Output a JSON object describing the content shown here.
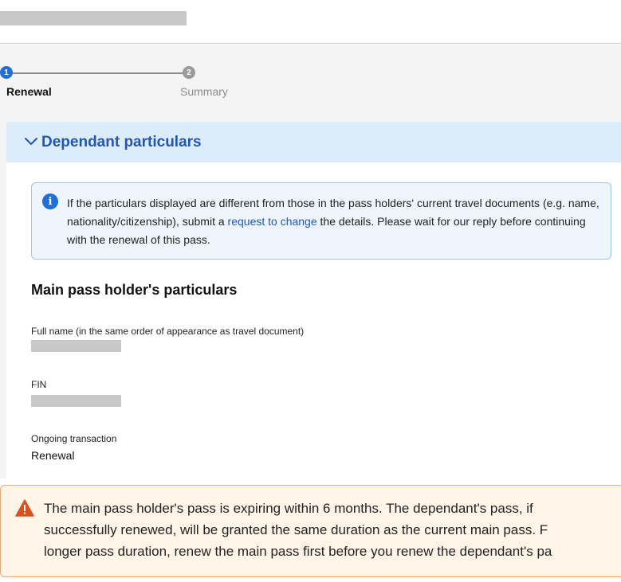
{
  "stepper": {
    "steps": [
      {
        "number": "1",
        "label": "Renewal",
        "active": true
      },
      {
        "number": "2",
        "label": "Summary",
        "active": false
      }
    ]
  },
  "accordion": {
    "title": "Dependant particulars",
    "icon": "chevron-down-icon"
  },
  "info": {
    "icon": "info-icon",
    "text_before": "If the particulars displayed are different from those in the pass holders' current travel documents (e.g. name, nationality/citizenship), submit a ",
    "link": "request to change",
    "text_after": " the details. Please wait for our reply before continuing with the renewal of this pass."
  },
  "main_holder": {
    "title": "Main pass holder's particulars",
    "fields": [
      {
        "label": "Full name (in the same order of appearance as travel document)",
        "value": ""
      },
      {
        "label": "FIN",
        "value": ""
      },
      {
        "label": "Ongoing transaction",
        "value": "Renewal"
      }
    ]
  },
  "warning": {
    "icon": "warning-icon",
    "lines": [
      "The main pass holder's pass is expiring within 6 months. The dependant's pass, if",
      "successfully renewed, will be granted the same duration as the current main pass. F",
      "longer pass duration, renew the main pass first before you renew the dependant's pa"
    ]
  },
  "colors": {
    "accent": "#1f6fd6",
    "accordion_bg": "#dcecf9",
    "accordion_text": "#2157b3",
    "info_bg": "#eef5fd",
    "warning_bg": "#fff4e8",
    "warning_border": "#e6a774",
    "warning_icon": "#d9531e"
  }
}
